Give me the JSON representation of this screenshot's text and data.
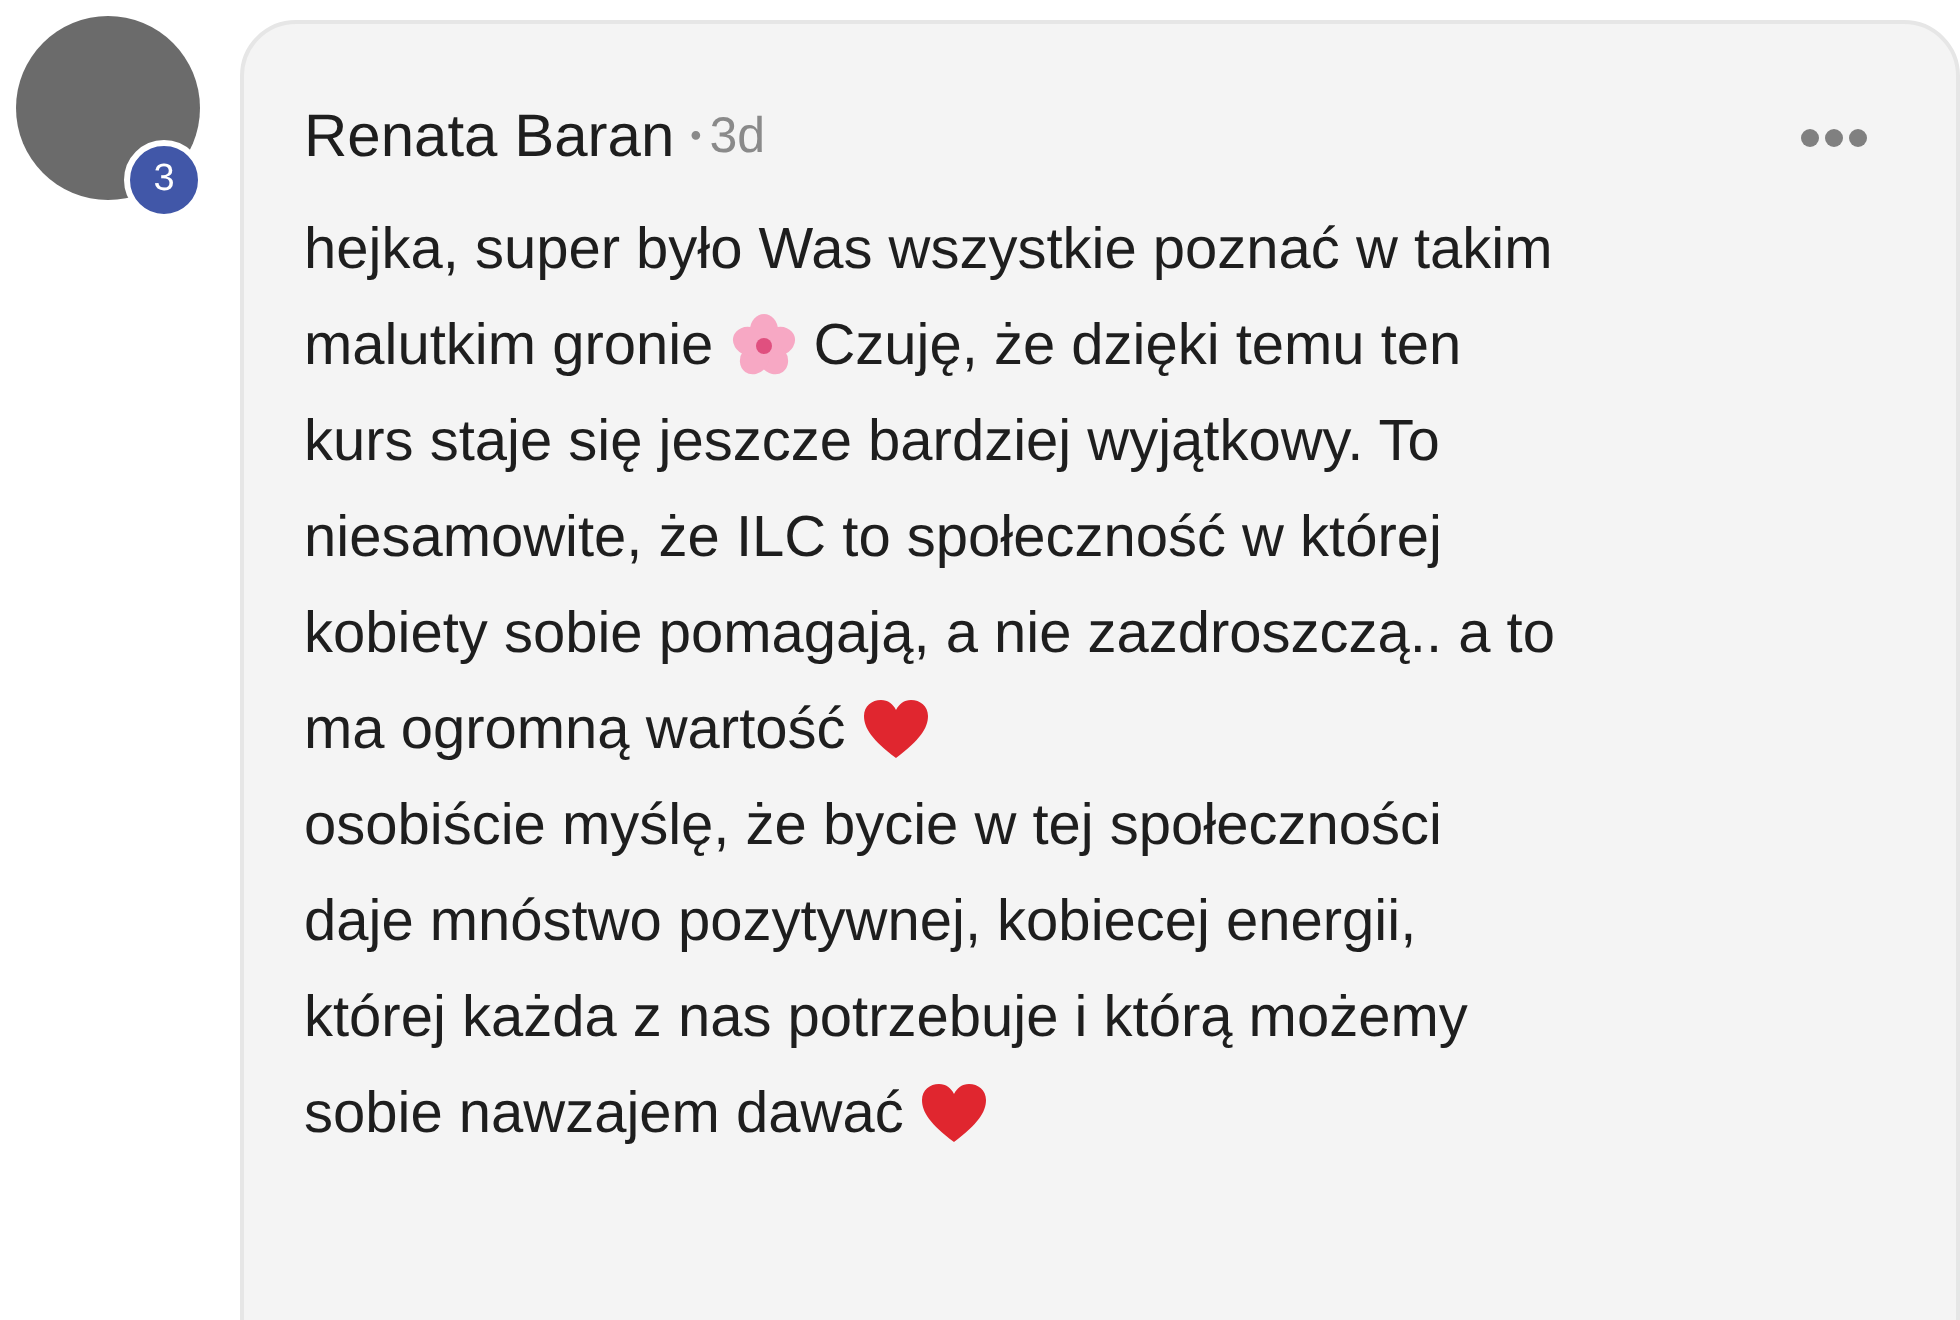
{
  "comment": {
    "author": "Renata Baran",
    "separator": "•",
    "time": "3d",
    "badge": "3",
    "lines": [
      [
        {
          "kind": "text",
          "text": "hejka, super było Was wszystkie poznać w takim"
        }
      ],
      [
        {
          "kind": "text",
          "text": "malutkim gronie"
        },
        {
          "kind": "flower"
        },
        {
          "kind": "text",
          "text": "Czuję, że dzięki temu ten"
        }
      ],
      [
        {
          "kind": "text",
          "text": "kurs staje się jeszcze bardziej wyjątkowy. To"
        }
      ],
      [
        {
          "kind": "text",
          "text": "niesamowite, że ILC to społeczność w której"
        }
      ],
      [
        {
          "kind": "text",
          "text": "kobiety sobie pomagają, a nie zazdroszczą.. a to"
        }
      ],
      [
        {
          "kind": "text",
          "text": "ma ogromną wartość"
        },
        {
          "kind": "heart"
        }
      ],
      [
        {
          "kind": "text",
          "text": "osobiście myślę, że bycie w tej społeczności"
        }
      ],
      [
        {
          "kind": "text",
          "text": "daje mnóstwo pozytywnej, kobiecej energii,"
        }
      ],
      [
        {
          "kind": "text",
          "text": "której każda z nas potrzebuje i którą możemy"
        }
      ],
      [
        {
          "kind": "text",
          "text": "sobie nawzajem dawać"
        },
        {
          "kind": "heart"
        }
      ]
    ]
  }
}
